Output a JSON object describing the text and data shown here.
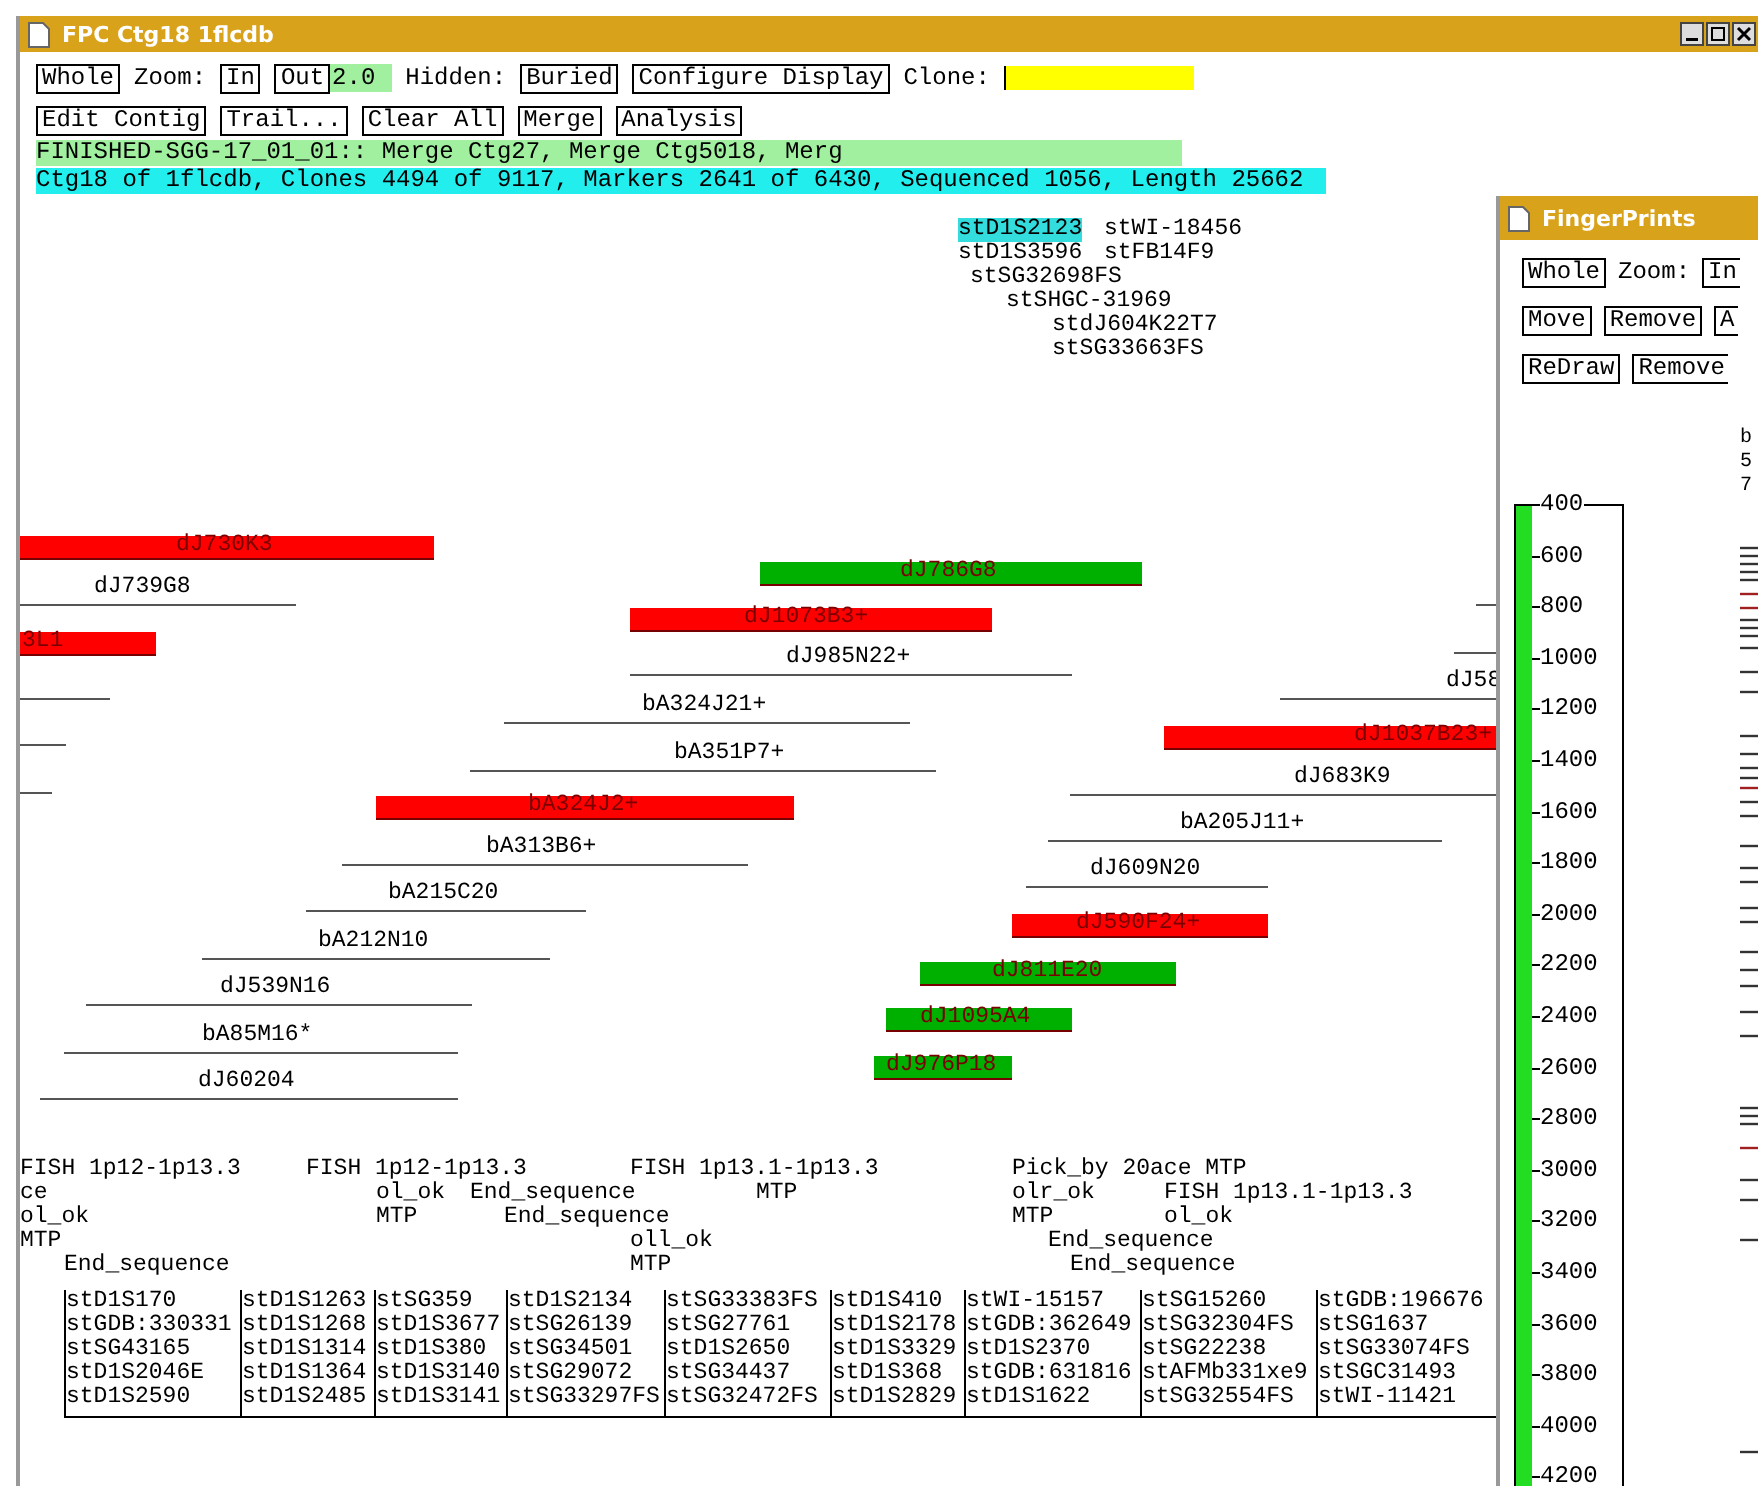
{
  "window": {
    "title": "FPC Ctg18 1flcdb"
  },
  "toolbar_rows": [
    [
      {
        "kind": "button",
        "label": "Whole"
      },
      {
        "kind": "label",
        "label": "Zoom:"
      },
      {
        "kind": "button",
        "label": "In"
      },
      {
        "kind": "button",
        "label": "Out"
      },
      {
        "kind": "value",
        "label": "2.0"
      },
      {
        "kind": "label",
        "label": "Hidden:"
      },
      {
        "kind": "button",
        "label": "Buried"
      },
      {
        "kind": "button",
        "label": "Configure Display"
      },
      {
        "kind": "label",
        "label": "Clone:"
      },
      {
        "kind": "field"
      }
    ],
    [
      {
        "kind": "button",
        "label": "Edit Contig"
      },
      {
        "kind": "button",
        "label": "Trail..."
      },
      {
        "kind": "button",
        "label": "Clear All"
      },
      {
        "kind": "button",
        "label": "Merge"
      },
      {
        "kind": "button",
        "label": "Analysis"
      }
    ]
  ],
  "status_lines": [
    {
      "kind": "history",
      "text": "FINISHED-SGG-17_01_01:: Merge Ctg27,  Merge Ctg5018, Merg"
    },
    {
      "kind": "summary",
      "text": "Ctg18 of 1flcdb, Clones 4494 of 9117, Markers 2641 of 6430, Sequenced 1056, Length 25662"
    }
  ],
  "markers": [
    {
      "name": "stD1S2123",
      "highlighted": true
    },
    {
      "name": "stWI-18456",
      "highlighted": false
    },
    {
      "name": "stD1S3596",
      "highlighted": false
    },
    {
      "name": "stFB14F9",
      "highlighted": false
    },
    {
      "name": "stSG32698FS",
      "highlighted": false
    },
    {
      "name": "stSHGC-31969",
      "highlighted": false
    },
    {
      "name": "stdJ604K22T7",
      "highlighted": false
    },
    {
      "name": "stSG33663FS",
      "highlighted": false
    }
  ],
  "clones": [
    {
      "name": "dJ730K3",
      "kind": "bar",
      "color": "#ff0000"
    },
    {
      "name": "dJ786G8",
      "kind": "bar",
      "color": "#00b000"
    },
    {
      "name": "dJ739G8",
      "kind": "line"
    },
    {
      "kind": "line"
    },
    {
      "name": "dJ1073B3+",
      "kind": "bar",
      "color": "#ff0000"
    },
    {
      "name": "3L1",
      "kind": "bar",
      "color": "#ff0000"
    },
    {
      "kind": "line"
    },
    {
      "name": "dJ985N22+",
      "kind": "line"
    },
    {
      "kind": "line"
    },
    {
      "name": "dJ58",
      "kind": "line"
    },
    {
      "name": "bA324J21+",
      "kind": "line"
    },
    {
      "name": "dJ1037B23+",
      "kind": "bar",
      "color": "#ff0000"
    },
    {
      "kind": "line"
    },
    {
      "name": "bA351P7+",
      "kind": "line"
    },
    {
      "kind": "line"
    },
    {
      "name": "dJ683K9",
      "kind": "line"
    },
    {
      "name": "bA324J2+",
      "kind": "bar",
      "color": "#ff0000"
    },
    {
      "name": "bA205J11+",
      "kind": "line"
    },
    {
      "name": "bA313B6+",
      "kind": "line"
    },
    {
      "name": "dJ609N20",
      "kind": "line"
    },
    {
      "name": "bA215C20",
      "kind": "line"
    },
    {
      "name": "dJ590F24+",
      "kind": "bar",
      "color": "#ff0000"
    },
    {
      "name": "bA212N10",
      "kind": "line"
    },
    {
      "name": "dJ811E20",
      "kind": "bar",
      "color": "#00b000"
    },
    {
      "name": "dJ539N16",
      "kind": "line"
    },
    {
      "name": "dJ1095A4",
      "kind": "bar",
      "color": "#00b000"
    },
    {
      "name": "bA85M16*",
      "kind": "line"
    },
    {
      "name": "dJ976P18",
      "kind": "bar",
      "color": "#00b000"
    },
    {
      "name": "dJ60204",
      "kind": "line"
    }
  ],
  "remarks": [
    "FISH 1p12-1p13.3",
    "FISH 1p12-1p13.3",
    "FISH 1p13.1-1p13.3",
    "Pick_by 20ace MTP",
    "ce",
    "ol_ok",
    "End_sequence",
    "MTP",
    "olr_ok",
    "FISH 1p13.1-1p13.3",
    "ol_ok",
    "MTP",
    "End_sequence",
    "MTP",
    "ol_ok",
    "MTP",
    "oll_ok",
    "End_sequence",
    "End_sequence",
    "MTP",
    "End_sequence"
  ],
  "marker_columns": [
    [
      "stD1S170",
      "stGDB:330331",
      "stSG43165",
      "stD1S2046E",
      "stD1S2590"
    ],
    [
      "stD1S1263",
      "stD1S1268",
      "stD1S1314",
      "stD1S1364",
      "stD1S2485"
    ],
    [
      "stSG359",
      "stD1S3677",
      "stD1S380",
      "stD1S3140",
      "stD1S3141"
    ],
    [
      "stD1S2134",
      "stSG26139",
      "stSG34501",
      "stSG29072",
      "stSG33297FS"
    ],
    [
      "stSG33383FS",
      "stSG27761",
      "stD1S2650",
      "stSG34437",
      "stSG32472FS"
    ],
    [
      "stD1S410",
      "stD1S2178",
      "stD1S3329",
      "stD1S368",
      "stD1S2829"
    ],
    [
      "stWI-15157",
      "stGDB:362649",
      "stD1S2370",
      "stGDB:631816",
      "stD1S1622"
    ],
    [
      "stSG15260",
      "stSG32304FS",
      "stSG22238",
      "stAFMb331xe9",
      "stSG32554FS"
    ],
    [
      "stGDB:196676",
      "stSG1637",
      "stSG33074FS",
      "stSGC31493",
      "stWI-11421"
    ]
  ],
  "fingerprints": {
    "title": "FingerPrints",
    "toolbar_rows": [
      [
        {
          "kind": "button",
          "label": "Whole"
        },
        {
          "kind": "label",
          "label": "Zoom:"
        },
        {
          "kind": "button",
          "label": "In"
        }
      ],
      [
        {
          "kind": "button",
          "label": "Move"
        },
        {
          "kind": "button",
          "label": "Remove"
        },
        {
          "kind": "button",
          "label": "A"
        }
      ],
      [
        {
          "kind": "button",
          "label": "ReDraw"
        },
        {
          "kind": "button",
          "label": "Remove"
        }
      ]
    ],
    "header_lines": [
      "b",
      "5",
      "7"
    ],
    "ruler_ticks": [
      "400",
      "600",
      "800",
      "1000",
      "1200",
      "1400",
      "1600",
      "1800",
      "2000",
      "2200",
      "2400",
      "2600",
      "2800",
      "3000",
      "3200",
      "3400",
      "3600",
      "3800",
      "4000",
      "4200"
    ]
  }
}
